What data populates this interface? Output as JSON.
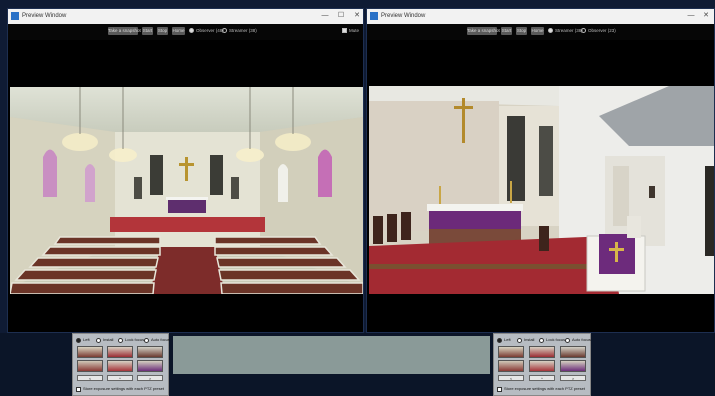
{
  "left_window": {
    "title": "Preview Window",
    "controls": [
      "—",
      "☐",
      "✕"
    ],
    "toolbar": {
      "buttons": [
        "Take a snapshot",
        "Start",
        "Stop",
        "Home"
      ],
      "radios": [
        {
          "label": "Observer (48)",
          "selected": true
        },
        {
          "label": "Streamer (38)",
          "selected": false
        }
      ],
      "checkbox": {
        "label": "Mute",
        "checked": true
      }
    },
    "video": {
      "scene": "church nave from rear"
    }
  },
  "right_window": {
    "title": "Preview Window",
    "controls": [
      "—",
      "✕"
    ],
    "toolbar": {
      "buttons": [
        "Take a snapshot",
        "Start",
        "Stop",
        "Home"
      ],
      "radios": [
        {
          "label": "Streamer (38)",
          "selected": true
        },
        {
          "label": "Observer (23)",
          "selected": false
        }
      ]
    },
    "video": {
      "scene": "church chancel and altar"
    }
  },
  "left_panel": {
    "options": [
      {
        "label": "Left",
        "selected": true
      },
      {
        "label": "Install",
        "selected": false
      },
      {
        "label": "Lock focus",
        "selected": false
      },
      {
        "label": "Auto focus",
        "selected": false
      }
    ],
    "arrows": [
      "<",
      "^",
      ">"
    ],
    "footer_check": "Store exposure settings with each PTZ preset"
  },
  "right_panel": {
    "options": [
      {
        "label": "Left",
        "selected": true
      },
      {
        "label": "Install",
        "selected": false
      },
      {
        "label": "Lock focus",
        "selected": false
      },
      {
        "label": "Auto focus",
        "selected": false
      }
    ],
    "arrows": [
      "<",
      "^",
      ">"
    ],
    "footer_check": "Store exposure settings with each PTZ preset"
  },
  "colors": {
    "frame": "#0f1b34",
    "video_bg": "#000000",
    "panel": "#b7bcc2",
    "titlebar": "#f2f2f2"
  }
}
